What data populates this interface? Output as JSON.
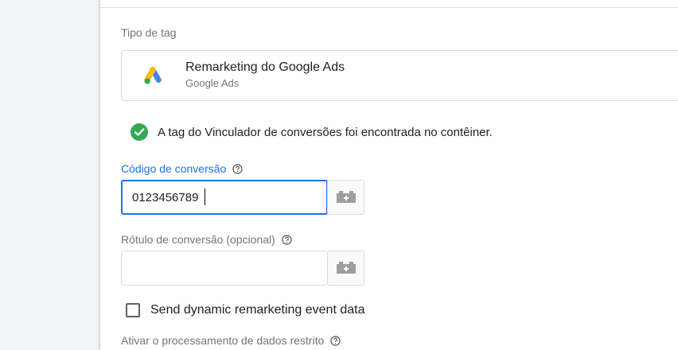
{
  "tag_type": {
    "section_label": "Tipo de tag",
    "name": "Remarketing do Google Ads",
    "provider": "Google Ads",
    "icon": "google-ads-icon"
  },
  "notice": {
    "icon": "check-circle-icon",
    "text": "A tag do Vinculador de conversões foi encontrada no contêiner.",
    "color": "#34a853"
  },
  "conversion_code": {
    "label": "Código de conversão",
    "value": "0123456789",
    "help_icon": "help-icon",
    "variable_icon": "variable-icon"
  },
  "conversion_label": {
    "label": "Rótulo de conversão (opcional)",
    "value": "",
    "help_icon": "help-icon",
    "variable_icon": "variable-icon"
  },
  "dynamic_remarketing": {
    "label": "Send dynamic remarketing event data",
    "checked": false
  },
  "restricted_data": {
    "label": "Ativar o processamento de dados restrito",
    "help_icon": "help-icon"
  },
  "colors": {
    "accent": "#1a73e8",
    "success": "#34a853",
    "text": "#202124",
    "muted": "#757575"
  }
}
